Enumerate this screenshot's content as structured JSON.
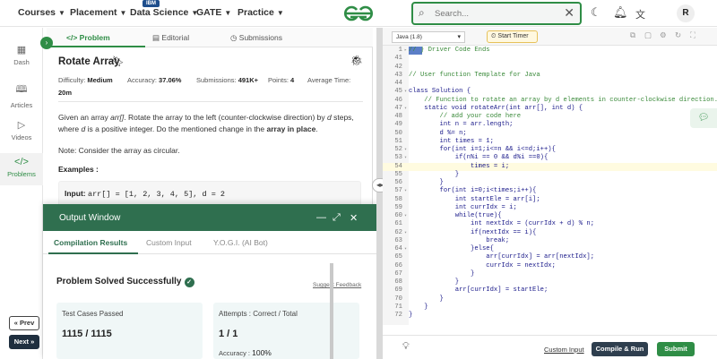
{
  "nav": {
    "items": [
      {
        "label": "Courses"
      },
      {
        "label": "Placement"
      },
      {
        "label": "Data Science"
      },
      {
        "label": "GATE"
      },
      {
        "label": "Practice"
      }
    ],
    "ibm_badge": "IBM",
    "search_placeholder": "Search...",
    "avatar_letter": "R",
    "brand_color": "#2f8d46"
  },
  "rail": {
    "items": [
      {
        "label": "Dash",
        "icon": "grid-icon"
      },
      {
        "label": "Articles",
        "icon": "book-icon"
      },
      {
        "label": "Videos",
        "icon": "video-icon"
      },
      {
        "label": "Problems",
        "icon": "code-icon"
      }
    ],
    "prev_label": "« Prev",
    "next_label": "Next »"
  },
  "problem": {
    "tabs": [
      {
        "label": "Problem"
      },
      {
        "label": "Editorial"
      },
      {
        "label": "Submissions"
      }
    ],
    "title": "Rotate Array",
    "difficulty_label": "Difficulty:",
    "difficulty": "Medium",
    "accuracy_label": "Accuracy:",
    "accuracy": "37.06%",
    "submissions_label": "Submissions:",
    "submissions": "491K+",
    "points_label": "Points:",
    "points": "4",
    "avg_time_label": "Average Time:",
    "avg_time": "20m",
    "desc_1": "Given an array ",
    "desc_arr": "arr[]",
    "desc_2": ". Rotate the array to the left (counter-clockwise direction) by ",
    "desc_d": "d",
    "desc_3": " steps, where ",
    "desc_d2": "d",
    "desc_4": " is a positive integer. Do the mentioned change in the ",
    "desc_bold": "array in place",
    "desc_5": ".",
    "note": "Note: Consider the array as circular.",
    "examples_label": "Examples :",
    "example_input_label": "Input:",
    "example_input_value": "arr[] = [1, 2, 3, 4, 5], d = 2"
  },
  "output": {
    "title": "Output Window",
    "tabs": [
      {
        "label": "Compilation Results"
      },
      {
        "label": "Custom Input"
      },
      {
        "label": "Y.O.G.I. (AI Bot)"
      }
    ],
    "status": "Problem Solved Successfully",
    "feedback": "Suggest Feedback",
    "tests_label": "Test Cases Passed",
    "tests_value": "1115 / 1115",
    "attempts_label": "Attempts : Correct / Total",
    "attempts_value": "1 / 1",
    "accuracy_label": "Accuracy :",
    "accuracy_value": "100%"
  },
  "editor": {
    "language": "Java (1.8)",
    "timer_label": "Start Timer",
    "custom_input": "Custom Input",
    "run_label": "Compile & Run",
    "submit_label": "Submit",
    "lines": [
      {
        "n": "1",
        "t": "// } Driver Code Ends",
        "cls": "cmt",
        "fold": "▸",
        "sel": "true"
      },
      {
        "n": "41",
        "t": "",
        "cls": ""
      },
      {
        "n": "42",
        "t": "",
        "cls": ""
      },
      {
        "n": "43",
        "t": "// User function Template for Java",
        "cls": "cmt"
      },
      {
        "n": "44",
        "t": "",
        "cls": ""
      },
      {
        "n": "45",
        "t": "class Solution {",
        "cls": "",
        "fold": "▾"
      },
      {
        "n": "46",
        "t": "    // Function to rotate an array by d elements in counter-clockwise direction.",
        "cls": "cmt"
      },
      {
        "n": "47",
        "t": "    static void rotateArr(int arr[], int d) {",
        "cls": "",
        "fold": "▾"
      },
      {
        "n": "48",
        "t": "        // add your code here",
        "cls": "cmt"
      },
      {
        "n": "49",
        "t": "        int n = arr.length;",
        "cls": ""
      },
      {
        "n": "50",
        "t": "        d %= n;",
        "cls": ""
      },
      {
        "n": "51",
        "t": "        int times = 1;",
        "cls": ""
      },
      {
        "n": "52",
        "t": "        for(int i=1;i<=n && i<=d;i++){",
        "cls": "",
        "fold": "▾"
      },
      {
        "n": "53",
        "t": "            if(n%i == 0 && d%i ==0){",
        "cls": "",
        "fold": "▾"
      },
      {
        "n": "54",
        "t": "                times = i;",
        "cls": "",
        "hl": "true"
      },
      {
        "n": "55",
        "t": "            }",
        "cls": ""
      },
      {
        "n": "56",
        "t": "        }",
        "cls": ""
      },
      {
        "n": "57",
        "t": "        for(int i=0;i<times;i++){",
        "cls": "",
        "fold": "▾"
      },
      {
        "n": "58",
        "t": "            int startEle = arr[i];",
        "cls": ""
      },
      {
        "n": "59",
        "t": "            int currIdx = i;",
        "cls": ""
      },
      {
        "n": "60",
        "t": "            while(true){",
        "cls": "",
        "fold": "▾"
      },
      {
        "n": "61",
        "t": "                int nextIdx = (currIdx + d) % n;",
        "cls": ""
      },
      {
        "n": "62",
        "t": "                if(nextIdx == i){",
        "cls": "",
        "fold": "▾"
      },
      {
        "n": "63",
        "t": "                    break;",
        "cls": ""
      },
      {
        "n": "64",
        "t": "                }else{",
        "cls": "",
        "fold": "▾"
      },
      {
        "n": "65",
        "t": "                    arr[currIdx] = arr[nextIdx];",
        "cls": ""
      },
      {
        "n": "66",
        "t": "                    currIdx = nextIdx;",
        "cls": ""
      },
      {
        "n": "67",
        "t": "                }",
        "cls": ""
      },
      {
        "n": "68",
        "t": "            }",
        "cls": ""
      },
      {
        "n": "69",
        "t": "            arr[currIdx] = startEle;",
        "cls": ""
      },
      {
        "n": "70",
        "t": "        }",
        "cls": ""
      },
      {
        "n": "71",
        "t": "    }",
        "cls": ""
      },
      {
        "n": "72",
        "t": "}",
        "cls": ""
      }
    ]
  }
}
